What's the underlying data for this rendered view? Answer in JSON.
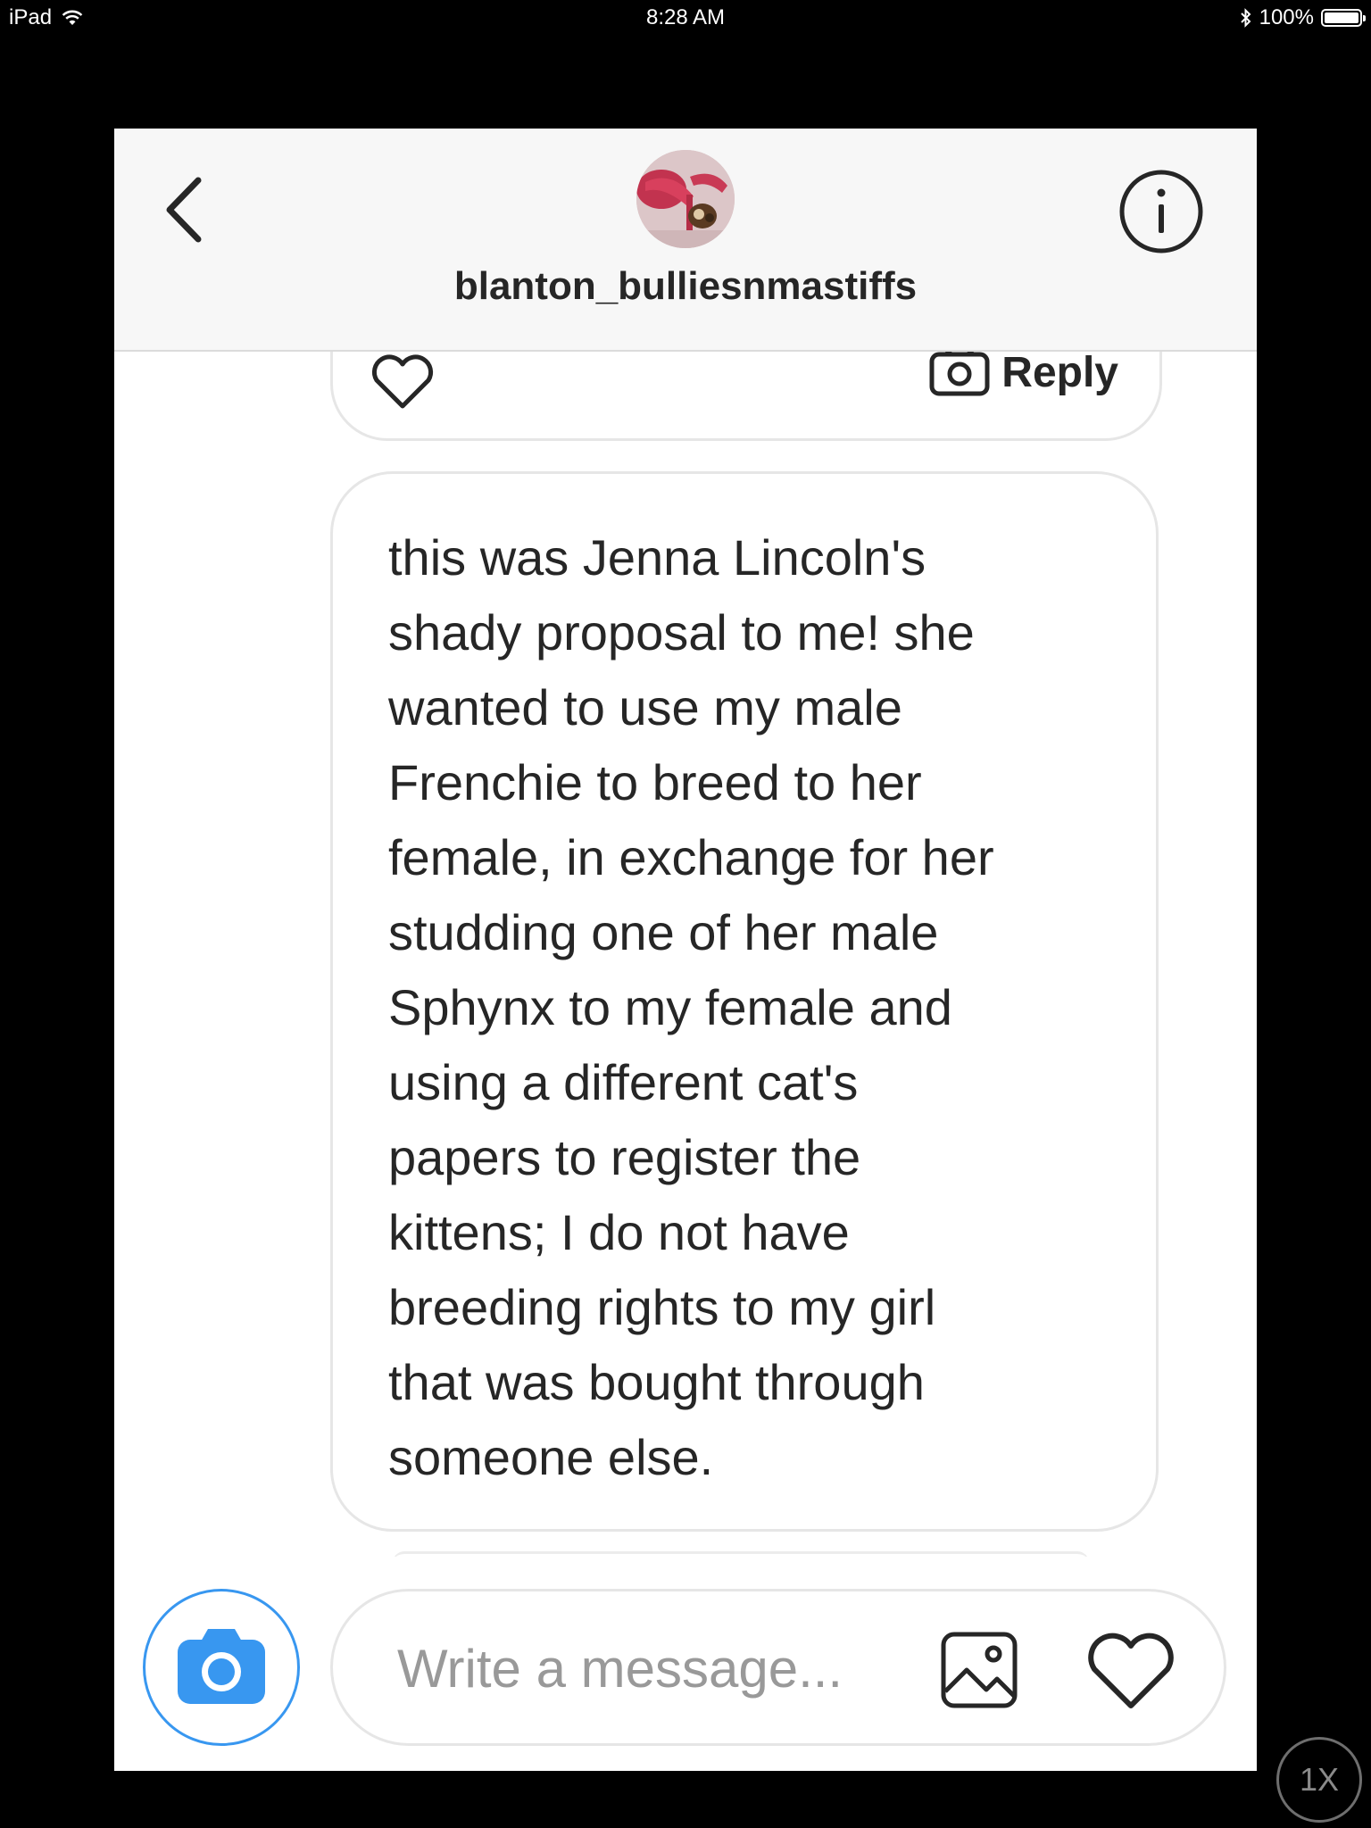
{
  "status_bar": {
    "device": "iPad",
    "time": "8:28 AM",
    "battery_percent": "100%",
    "battery_level": 1.0
  },
  "header": {
    "username": "blanton_bulliesnmastiffs",
    "back_icon": "chevron-left-icon",
    "info_icon": "info-circle-icon"
  },
  "thread": {
    "previous_message": {
      "reply_label": "Reply",
      "like_icon": "heart-outline-icon",
      "reply_icon": "camera-icon"
    },
    "message": {
      "text": "this was Jenna Lincoln's\nshady proposal to me! she\nwanted to use my male\nFrenchie to breed to her\nfemale, in exchange for her\nstudding one of her male\nSphynx to my female and\nusing a different cat's\npapers to register the\nkittens; I do not have\nbreeding rights to my girl\nthat was bought through\nsomeone else."
    }
  },
  "composer": {
    "placeholder": "Write a message...",
    "value": "",
    "camera_icon": "camera-icon",
    "gallery_icon": "image-icon",
    "like_icon": "heart-outline-icon"
  },
  "overlay": {
    "zoom_label": "1X"
  },
  "colors": {
    "accent": "#3897f0",
    "text": "#262626",
    "placeholder": "#999999",
    "header_bg": "#f7f7f7",
    "bubble_border": "#e6e6e6"
  }
}
